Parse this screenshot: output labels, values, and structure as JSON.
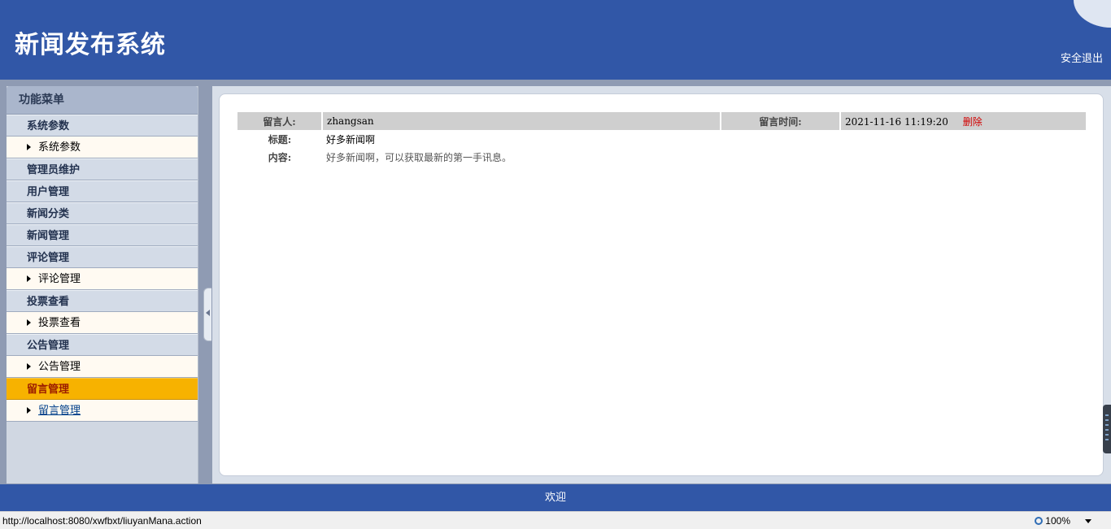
{
  "header": {
    "title": "新闻发布系统",
    "logout_label": "安全退出"
  },
  "sidebar": {
    "menu_title": "功能菜单",
    "items": [
      {
        "type": "group",
        "label": "系统参数"
      },
      {
        "type": "sub",
        "label": "系统参数"
      },
      {
        "type": "group",
        "label": "管理员维护"
      },
      {
        "type": "group",
        "label": "用户管理"
      },
      {
        "type": "group",
        "label": "新闻分类"
      },
      {
        "type": "group",
        "label": "新闻管理"
      },
      {
        "type": "group",
        "label": "评论管理"
      },
      {
        "type": "sub",
        "label": "评论管理"
      },
      {
        "type": "group",
        "label": "投票查看"
      },
      {
        "type": "sub",
        "label": "投票查看"
      },
      {
        "type": "group",
        "label": "公告管理"
      },
      {
        "type": "sub",
        "label": "公告管理"
      },
      {
        "type": "group",
        "label": "留言管理",
        "active": true
      },
      {
        "type": "sub",
        "label": "留言管理",
        "active": true
      }
    ]
  },
  "message": {
    "author_label": "留言人:",
    "author_value": "zhangsan",
    "time_label": "留言时间:",
    "time_value": "2021-11-16 11:19:20",
    "delete_label": "删除",
    "title_label": "标题:",
    "title_value": "好多新闻啊",
    "content_label": "内容:",
    "content_value": "好多新闻啊，可以获取最新的第一手讯息。"
  },
  "footer": {
    "text": "欢迎"
  },
  "statusbar": {
    "url": "http://localhost:8080/xwfbxt/liuyanMana.action",
    "zoom": "100%"
  },
  "colors": {
    "brand_blue": "#3157a7",
    "active_menu": "#f7b200",
    "delete_red": "#d10000"
  }
}
